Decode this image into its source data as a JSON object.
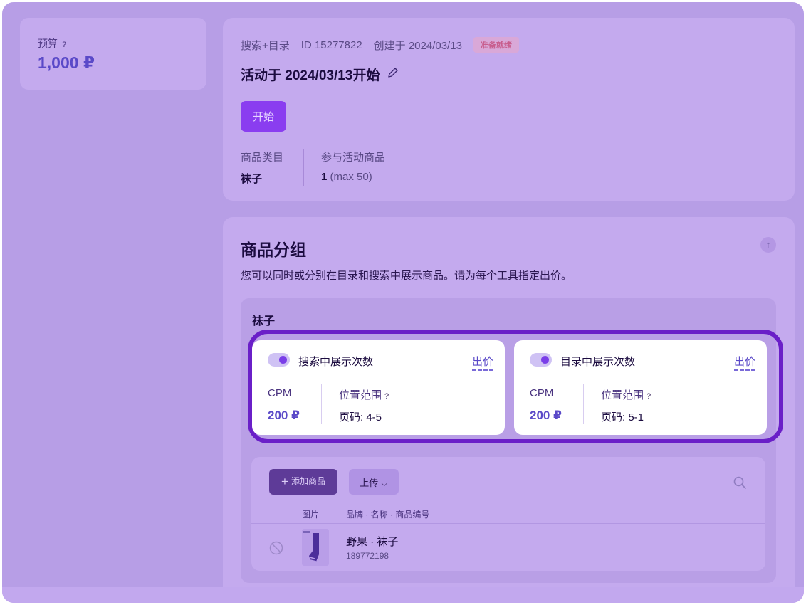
{
  "budget": {
    "label": "预算",
    "help": "?",
    "value": "1,000 ₽"
  },
  "campaign": {
    "type": "搜索+目录",
    "id": "ID 15277822",
    "created": "创建于 2024/03/13",
    "status": "准备就绪",
    "title": "活动于 2024/03/13开始",
    "edit_icon": "pencil-icon",
    "start_label": "开始",
    "category_label": "商品类目",
    "category_value": "袜子",
    "products_label": "参与活动商品",
    "products_count": "1",
    "products_max": "(max 50)"
  },
  "groups": {
    "title": "商品分组",
    "description": "您可以同时或分别在目录和搜索中展示商品。请为每个工具指定出价。",
    "collapse_icon": "arrow-up-icon",
    "group_name": "袜子",
    "placements": [
      {
        "title": "搜索中展示次数",
        "bid_label": "出价",
        "cpm_label": "CPM",
        "cpm_value": "200 ₽",
        "range_label": "位置范围",
        "range_help": "?",
        "range_value": "页码: 4-5",
        "enabled": true
      },
      {
        "title": "目录中展示次数",
        "bid_label": "出价",
        "cpm_label": "CPM",
        "cpm_value": "200 ₽",
        "range_label": "位置范围",
        "range_help": "?",
        "range_value": "页码: 5-1",
        "enabled": true
      }
    ],
    "products": {
      "add_label": "添加商品",
      "upload_label": "上传",
      "col_image": "图片",
      "col_info": "品牌 · 名称 · 商品编号",
      "items": [
        {
          "name": "野果 · 袜子",
          "id": "189772198"
        }
      ]
    }
  },
  "colors": {
    "accent": "#8a3df0",
    "highlight": "#6a1fc8",
    "price": "#5a49c8"
  }
}
